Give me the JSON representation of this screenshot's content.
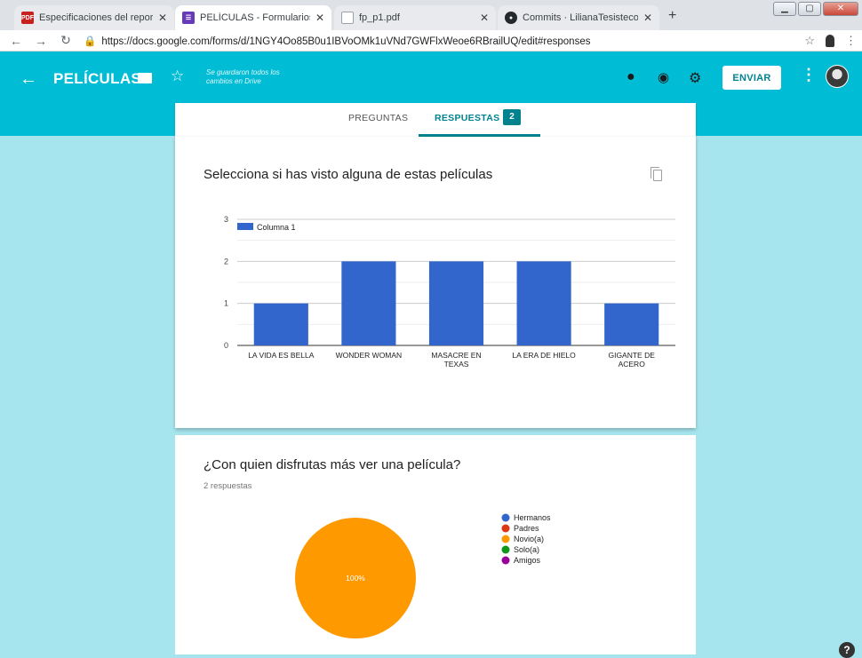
{
  "browser": {
    "tabs": [
      {
        "title": "Especificaciones del reporte de l",
        "favicon": "pdf-icon",
        "color": "#c5221f",
        "active": false
      },
      {
        "title": "PELÍCULAS - Formularios de Goo",
        "favicon": "forms-icon",
        "color": "#673ab7",
        "active": true
      },
      {
        "title": "fp_p1.pdf",
        "favicon": "document-icon",
        "color": "#9aa0a6",
        "active": false
      },
      {
        "title": "Commits · LilianaTesisteco/Repo",
        "favicon": "github-icon",
        "color": "#24292e",
        "active": false
      }
    ],
    "pdf_badge": "PDF",
    "url": "https://docs.google.com/forms/d/1NGY4Oo85B0u1IBVoOMk1uVNd7GWFlxWeoe6RBrailUQ/edit#responses"
  },
  "header": {
    "title": "PELÍCULAS",
    "saved_status": "Se guardaron todos los cambios en Drive",
    "send_label": "ENVIAR",
    "color": "#00bcd4"
  },
  "tabs": {
    "questions_label": "PREGUNTAS",
    "responses_label": "RESPUESTAS",
    "responses_count": "2",
    "accent": "#00838f"
  },
  "question1": {
    "title": "Selecciona si has visto alguna de estas películas"
  },
  "question2": {
    "title": "¿Con quien disfrutas más ver una película?",
    "subtitle": "2 respuestas"
  },
  "chart_data": [
    {
      "type": "bar",
      "categories": [
        "LA VIDA ES BELLA",
        "WONDER WOMAN",
        "MASACRE EN TEXAS",
        "LA ERA DE HIELO",
        "GIGANTE DE ACERO"
      ],
      "category_lines": [
        [
          "LA VIDA ES BELLA"
        ],
        [
          "WONDER WOMAN"
        ],
        [
          "MASACRE EN",
          "TEXAS"
        ],
        [
          "LA ERA DE HIELO"
        ],
        [
          "GIGANTE DE",
          "ACERO"
        ]
      ],
      "series": [
        {
          "name": "Columna 1",
          "values": [
            1,
            2,
            2,
            2,
            1
          ],
          "color": "#3366cc"
        }
      ],
      "yticks": [
        0,
        1,
        2,
        3
      ],
      "ylim": [
        0,
        3
      ],
      "legend_position": "top-left",
      "grid": true
    },
    {
      "type": "pie",
      "labels": [
        "Hermanos",
        "Padres",
        "Novio(a)",
        "Solo(a)",
        "Amigos"
      ],
      "values": [
        0,
        0,
        2,
        0,
        0
      ],
      "colors": [
        "#3366cc",
        "#dc3912",
        "#ff9900",
        "#109618",
        "#990099"
      ],
      "slice_label": "100%",
      "legend_position": "right"
    }
  ]
}
